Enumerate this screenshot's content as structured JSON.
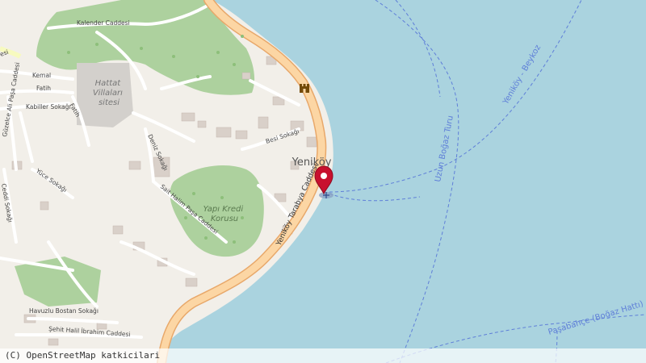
{
  "map": {
    "district_label": "Yeniköy",
    "water_routes": [
      "Uzun Boğaz Turu",
      "Yeniköy - Beykoz",
      "Paşabahçe (Boğaz Hattı)"
    ],
    "area_labels": {
      "hattat": "Hattat Villaları sitesi",
      "hattat_l1": "Hattat",
      "hattat_l2": "Villaları",
      "hattat_l3": "sitesi",
      "yapi_kredi_l1": "Yapı Kredi",
      "yapi_kredi_l2": "Korusu"
    },
    "street_labels": {
      "kalender": "Kalender Caddesi",
      "kemal": "Kemal",
      "fatih1": "Fatih",
      "fatih2": "Fatih",
      "kabiller": "Kabiller Sokağı",
      "guzelce": "Güzelce Ali Paşa Caddesi",
      "yuce": "Yüce Sokağı",
      "ceddi": "Ceddi Sokağı",
      "deniz": "Deniz Sokağı",
      "besi": "Besi Sokağı",
      "sait_halim": "Sait Halim Paşa Caddesi",
      "tarabya": "Yeniköy Tarabya Caddesi",
      "havuzlu": "Havuzlu Bostan Sokağı",
      "sehit": "Şehit Halil İbrahim Caddesi",
      "esi": "esi"
    },
    "attribution": "(C) OpenStreetMap katkicilari",
    "colors": {
      "water": "#aad3df",
      "land": "#f2efe9",
      "park": "#add19e",
      "grass": "#cdebb0",
      "primary_road": "#fcd6a4",
      "road_casing": "#e8a86a",
      "building": "#d9d0c9",
      "marker": "#c8102e",
      "ferry_route": "#5f7fd8",
      "route_label": "#5f7fd8"
    },
    "icons": [
      "castle-icon",
      "map-marker-icon",
      "ferry-pier-icon"
    ]
  }
}
